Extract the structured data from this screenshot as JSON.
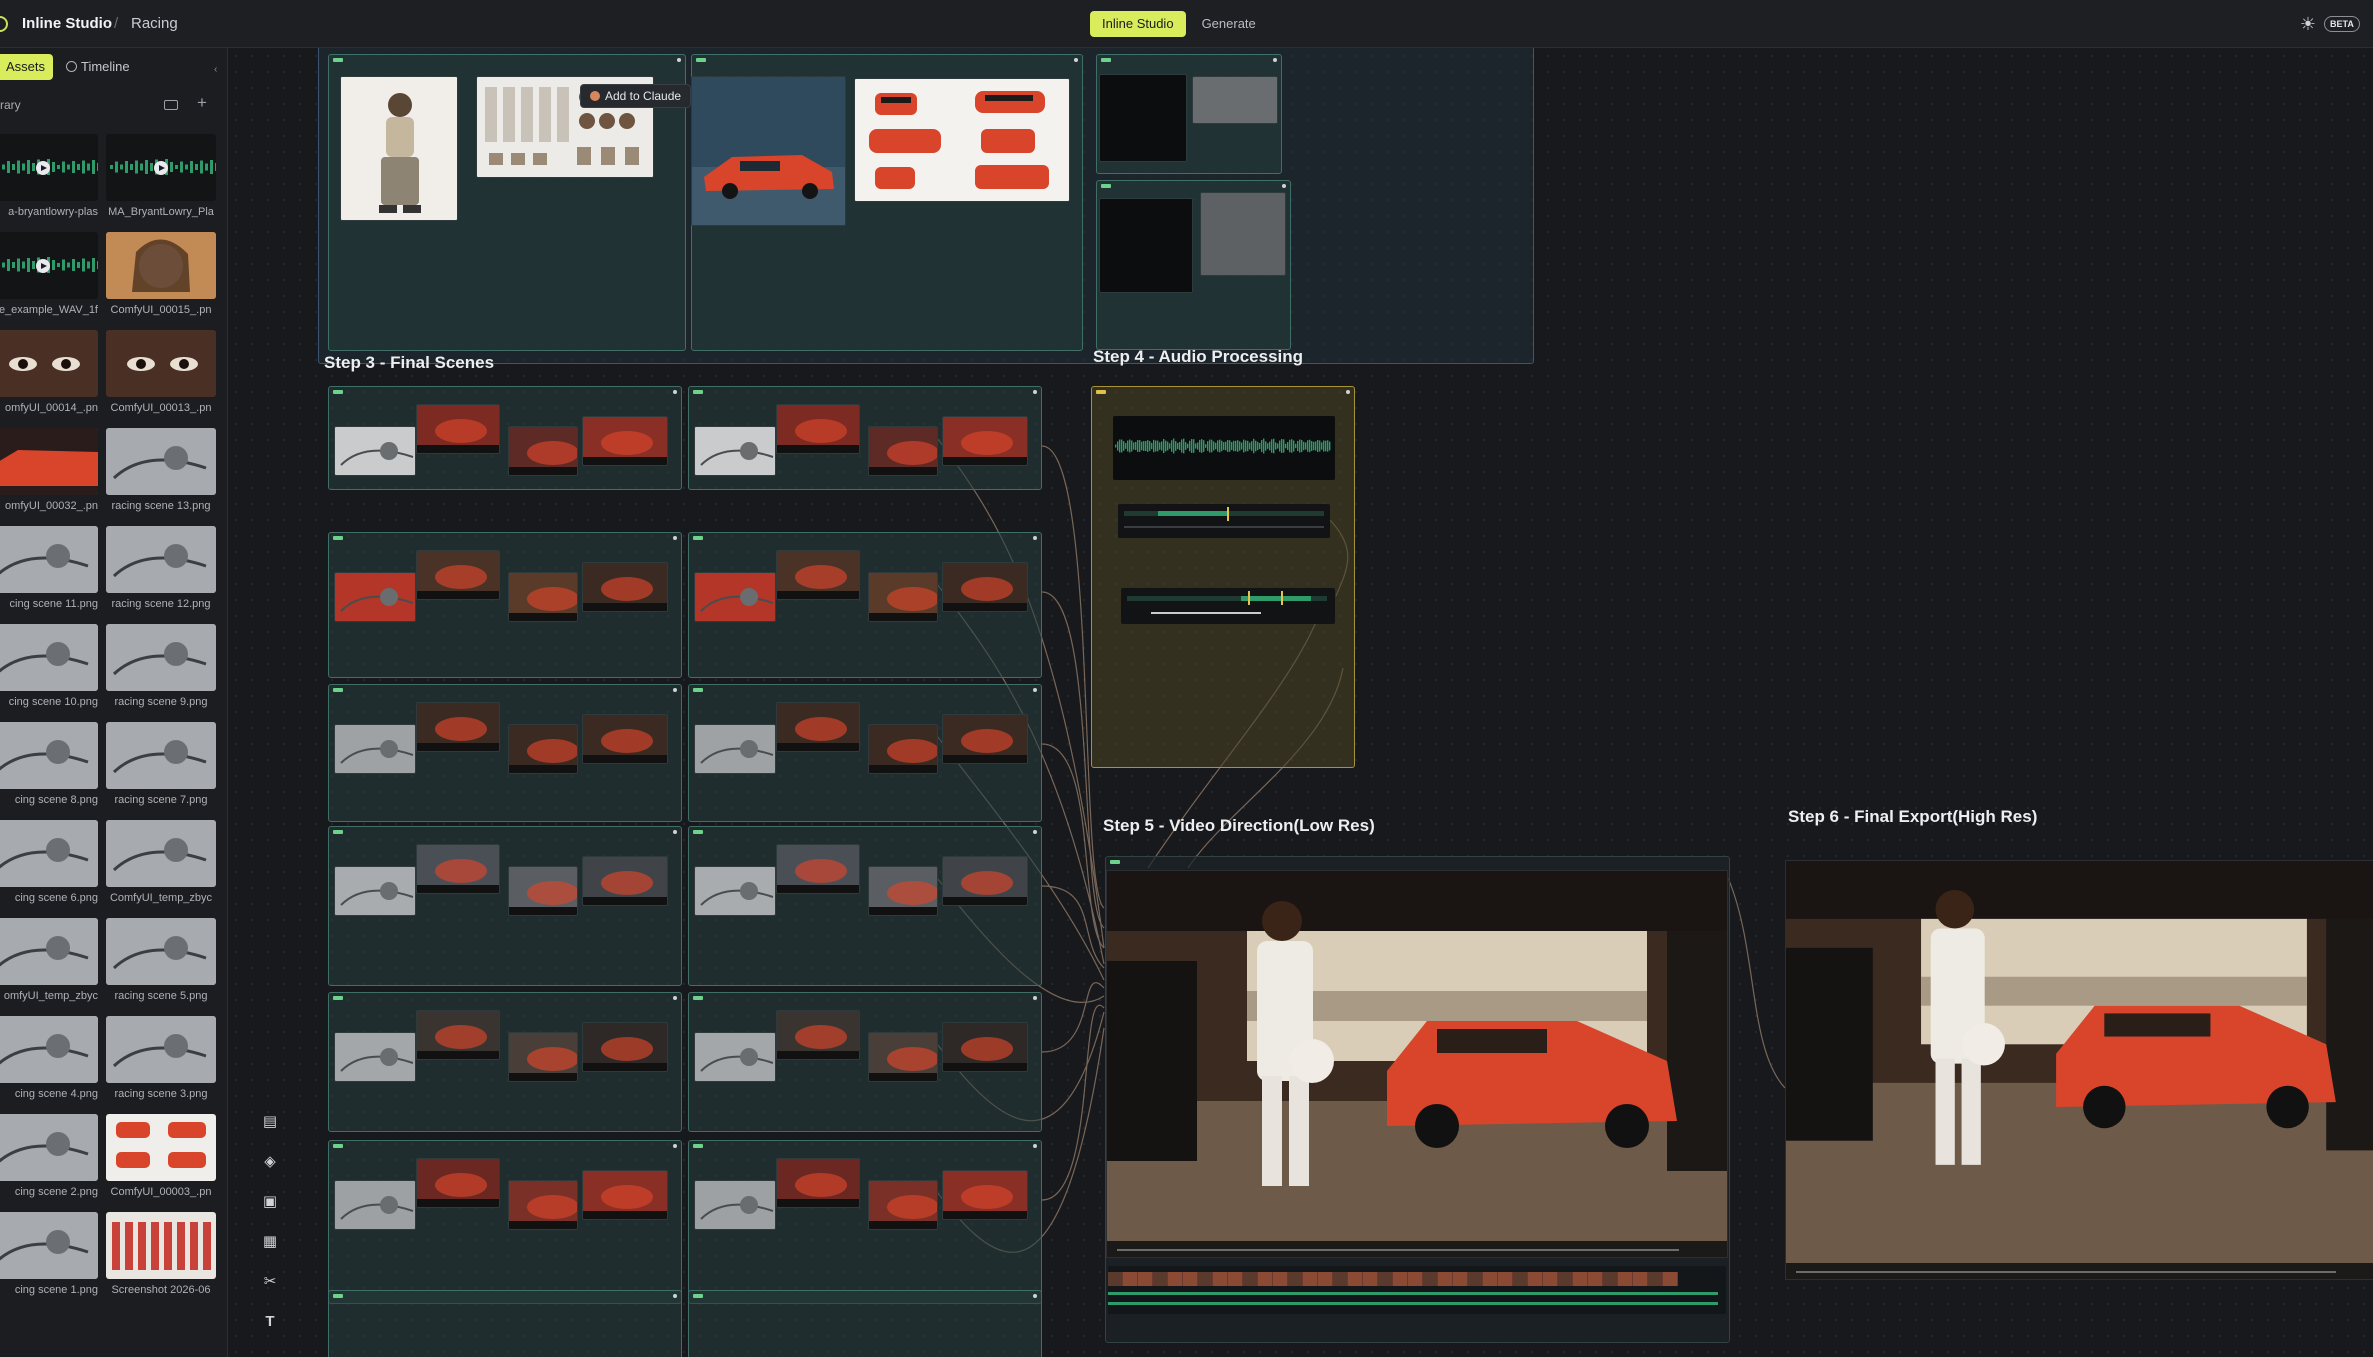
{
  "app": {
    "title": "Inline Studio",
    "project": "Racing",
    "separator": "/"
  },
  "mode_tabs": [
    {
      "label": "Inline Studio",
      "active": true
    },
    {
      "label": "Generate",
      "active": false
    }
  ],
  "header": {
    "beta_label": "BETA",
    "theme_icon": "sun-icon"
  },
  "sidebar": {
    "tabs": {
      "assets": "Assets",
      "timeline": "Timeline"
    },
    "library_label": "rary",
    "assets": [
      {
        "label": "a-bryantlowry-plas",
        "kind": "audio"
      },
      {
        "label": "MA_BryantLowry_Pla",
        "kind": "audio"
      },
      {
        "label": "e_example_WAV_1f",
        "kind": "audio"
      },
      {
        "label": "ComfyUI_00015_.pn",
        "kind": "portrait"
      },
      {
        "label": "omfyUI_00014_.pn",
        "kind": "eyes"
      },
      {
        "label": "ComfyUI_00013_.pn",
        "kind": "eyes"
      },
      {
        "label": "omfyUI_00032_.pn",
        "kind": "car"
      },
      {
        "label": "racing scene 13.png",
        "kind": "sketch"
      },
      {
        "label": "cing scene 11.png",
        "kind": "sketch"
      },
      {
        "label": "racing scene 12.png",
        "kind": "sketch"
      },
      {
        "label": "cing scene 10.png",
        "kind": "sketch"
      },
      {
        "label": "racing scene 9.png",
        "kind": "sketch"
      },
      {
        "label": "cing scene 8.png",
        "kind": "sketch"
      },
      {
        "label": "racing scene 7.png",
        "kind": "sketch"
      },
      {
        "label": "cing scene 6.png",
        "kind": "sketch"
      },
      {
        "label": "ComfyUI_temp_zbyc",
        "kind": "sketch"
      },
      {
        "label": "omfyUI_temp_zbyc",
        "kind": "sketch"
      },
      {
        "label": "racing scene 5.png",
        "kind": "sketch"
      },
      {
        "label": "cing scene 4.png",
        "kind": "sketch"
      },
      {
        "label": "racing scene 3.png",
        "kind": "sketch"
      },
      {
        "label": "cing scene 2.png",
        "kind": "sketch"
      },
      {
        "label": "ComfyUI_00003_.pn",
        "kind": "cars-sheet"
      },
      {
        "label": "cing scene 1.png",
        "kind": "sketch"
      },
      {
        "label": "Screenshot 2026-06",
        "kind": "character-sheet"
      }
    ]
  },
  "tools": [
    "table-icon",
    "layers-icon",
    "image-icon",
    "film-icon",
    "scissors-icon",
    "text-icon"
  ],
  "canvas": {
    "add_to_claude": "Add to Claude",
    "steps": {
      "step3": "Step 3 - Final Scenes",
      "step4": "Step 4 - Audio Processing",
      "step5": "Step 5 - Video Direction(Low Res)",
      "step6": "Step 6 - Final Export(High Res)"
    }
  },
  "colors": {
    "accent": "#d9ec5c",
    "group_teal": "#3f6f66",
    "group_audio": "#a6943a",
    "wave_green": "#2f9a6a",
    "car_red": "#d8452b"
  }
}
